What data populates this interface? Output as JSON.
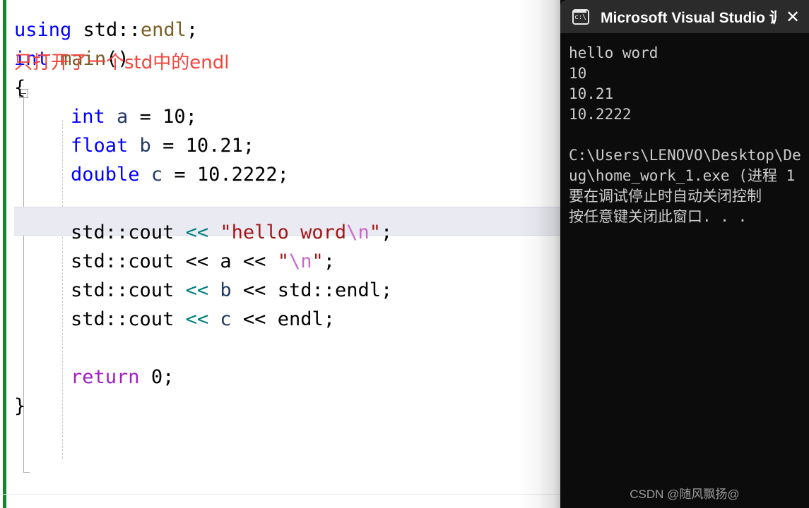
{
  "editor": {
    "name": "code-editor",
    "language": "cpp",
    "gutter": {
      "change_bar_color": "#12862b",
      "fold_marker": "collapse-minus"
    },
    "annotation": {
      "text": "只打开了一个std中的endl",
      "color": "#f4433a"
    },
    "current_line_index": 5,
    "lines": [
      {
        "indent": 0,
        "tokens": [
          {
            "t": "using",
            "c": "kw"
          },
          {
            "t": " ",
            "c": "plain"
          },
          {
            "t": "std",
            "c": "plain"
          },
          {
            "t": "::",
            "c": "plain"
          },
          {
            "t": "endl",
            "c": "fn"
          },
          {
            "t": ";",
            "c": "plain"
          }
        ]
      },
      {
        "indent": 0,
        "tokens": [
          {
            "t": "int",
            "c": "kw"
          },
          {
            "t": " ",
            "c": "plain"
          },
          {
            "t": "main",
            "c": "fn"
          },
          {
            "t": "()",
            "c": "plain"
          }
        ]
      },
      {
        "indent": 0,
        "tokens": [
          {
            "t": "{",
            "c": "plain"
          }
        ]
      },
      {
        "indent": 1,
        "tokens": [
          {
            "t": "int",
            "c": "kw"
          },
          {
            "t": " ",
            "c": "plain"
          },
          {
            "t": "a",
            "c": "var"
          },
          {
            "t": " = ",
            "c": "plain"
          },
          {
            "t": "10",
            "c": "num"
          },
          {
            "t": ";",
            "c": "plain"
          }
        ]
      },
      {
        "indent": 1,
        "tokens": [
          {
            "t": "float",
            "c": "kw"
          },
          {
            "t": " ",
            "c": "plain"
          },
          {
            "t": "b",
            "c": "var"
          },
          {
            "t": " = ",
            "c": "plain"
          },
          {
            "t": "10.21",
            "c": "num"
          },
          {
            "t": ";",
            "c": "plain"
          }
        ]
      },
      {
        "indent": 1,
        "tokens": [
          {
            "t": "double",
            "c": "kw"
          },
          {
            "t": " ",
            "c": "plain"
          },
          {
            "t": "c",
            "c": "var"
          },
          {
            "t": " = ",
            "c": "plain"
          },
          {
            "t": "10.2222",
            "c": "num"
          },
          {
            "t": ";",
            "c": "plain"
          }
        ]
      },
      {
        "indent": 1,
        "tokens": []
      },
      {
        "indent": 1,
        "tokens": [
          {
            "t": "std",
            "c": "plain"
          },
          {
            "t": "::",
            "c": "plain"
          },
          {
            "t": "cout",
            "c": "plain"
          },
          {
            "t": " ",
            "c": "plain"
          },
          {
            "t": "<<",
            "c": "op"
          },
          {
            "t": " ",
            "c": "plain"
          },
          {
            "t": "\"hello word",
            "c": "str"
          },
          {
            "t": "\\n",
            "c": "esc"
          },
          {
            "t": "\"",
            "c": "str"
          },
          {
            "t": ";",
            "c": "plain"
          }
        ]
      },
      {
        "indent": 1,
        "tokens": [
          {
            "t": "std",
            "c": "plain"
          },
          {
            "t": "::",
            "c": "plain"
          },
          {
            "t": "cout",
            "c": "plain"
          },
          {
            "t": " ",
            "c": "plain"
          },
          {
            "t": "<<",
            "c": "plain"
          },
          {
            "t": " ",
            "c": "plain"
          },
          {
            "t": "a",
            "c": "plain"
          },
          {
            "t": " ",
            "c": "plain"
          },
          {
            "t": "<<",
            "c": "plain"
          },
          {
            "t": " ",
            "c": "plain"
          },
          {
            "t": "\"",
            "c": "str"
          },
          {
            "t": "\\n",
            "c": "esc"
          },
          {
            "t": "\"",
            "c": "str"
          },
          {
            "t": ";",
            "c": "plain"
          }
        ]
      },
      {
        "indent": 1,
        "tokens": [
          {
            "t": "std",
            "c": "plain"
          },
          {
            "t": "::",
            "c": "plain"
          },
          {
            "t": "cout",
            "c": "plain"
          },
          {
            "t": " ",
            "c": "plain"
          },
          {
            "t": "<<",
            "c": "op"
          },
          {
            "t": " ",
            "c": "plain"
          },
          {
            "t": "b",
            "c": "var"
          },
          {
            "t": " ",
            "c": "plain"
          },
          {
            "t": "<<",
            "c": "plain"
          },
          {
            "t": " ",
            "c": "plain"
          },
          {
            "t": "std::endl",
            "c": "plain"
          },
          {
            "t": ";",
            "c": "plain"
          }
        ]
      },
      {
        "indent": 1,
        "tokens": [
          {
            "t": "std",
            "c": "plain"
          },
          {
            "t": "::",
            "c": "plain"
          },
          {
            "t": "cout",
            "c": "plain"
          },
          {
            "t": " ",
            "c": "plain"
          },
          {
            "t": "<<",
            "c": "op"
          },
          {
            "t": " ",
            "c": "plain"
          },
          {
            "t": "c",
            "c": "var"
          },
          {
            "t": " ",
            "c": "plain"
          },
          {
            "t": "<<",
            "c": "plain"
          },
          {
            "t": " ",
            "c": "plain"
          },
          {
            "t": "endl",
            "c": "plain"
          },
          {
            "t": ";",
            "c": "plain"
          }
        ]
      },
      {
        "indent": 1,
        "tokens": []
      },
      {
        "indent": 1,
        "tokens": [
          {
            "t": "return",
            "c": "ctl"
          },
          {
            "t": " ",
            "c": "plain"
          },
          {
            "t": "0",
            "c": "num"
          },
          {
            "t": ";",
            "c": "plain"
          }
        ]
      },
      {
        "indent": 0,
        "tokens": [
          {
            "t": "}",
            "c": "plain"
          }
        ]
      }
    ]
  },
  "console": {
    "title": "Microsoft Visual Studio 调试控",
    "icon": "console-cmd-icon",
    "close_label": "✕",
    "output_lines": [
      "hello word",
      "10",
      "10.21",
      "10.2222",
      "",
      "C:\\Users\\LENOVO\\Desktop\\De",
      "ug\\home_work_1.exe (进程 1",
      "要在调试停止时自动关闭控制",
      "按任意键关闭此窗口. . ."
    ],
    "watermark": "CSDN @随风飘扬@"
  }
}
